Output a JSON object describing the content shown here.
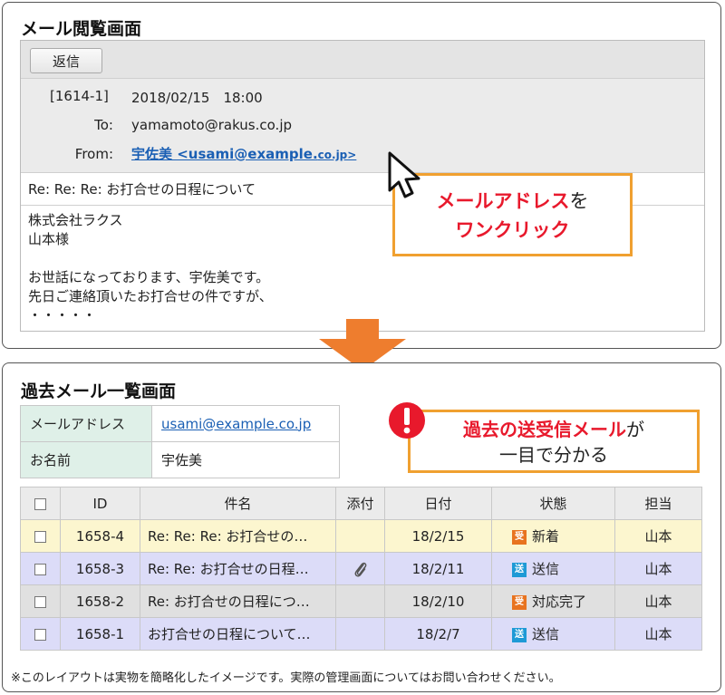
{
  "mail_view": {
    "title": "メール閲覧画面",
    "reply_label": "返信",
    "mail_no": "[1614-1]",
    "datetime": "2018/02/15　18:00",
    "to_label": "To:",
    "to_value": "yamamoto@rakus.co.jp",
    "from_label": "From:",
    "from_value_main": "宇佐美 <usami@example.",
    "from_value_tail": "co.jp>",
    "subject": "Re: Re: Re: お打合せの日程について",
    "body_lines": [
      "株式会社ラクス",
      "山本様",
      "",
      "お世話になっております、宇佐美です。",
      "先日ご連絡頂いたお打合せの件ですが、",
      "・・・・・"
    ],
    "callout_red": "メールアドレス",
    "callout_black": "を",
    "callout_line2": "ワンクリック"
  },
  "past_mail": {
    "title": "過去メール一覧画面",
    "info": {
      "address_label": "メールアドレス",
      "address_value": "usami@example.co.jp",
      "name_label": "お名前",
      "name_value": "宇佐美"
    },
    "callout_red": "過去の送受信メール",
    "callout_black": "が",
    "callout_line2": "一目で分かる",
    "columns": [
      "ID",
      "件名",
      "添付",
      "日付",
      "状態",
      "担当"
    ],
    "rows": [
      {
        "id": "1658-4",
        "subject": "Re: Re: Re: お打合せの…",
        "attach": "",
        "date": "18/2/15",
        "badge": "受",
        "status": "新着",
        "owner": "山本"
      },
      {
        "id": "1658-3",
        "subject": "Re: Re: お打合せの日程…",
        "attach": "paperclip-icon",
        "date": "18/2/11",
        "badge": "送",
        "status": "送信",
        "owner": "山本"
      },
      {
        "id": "1658-2",
        "subject": "Re: お打合せの日程につ…",
        "attach": "",
        "date": "18/2/10",
        "badge": "受",
        "status": "対応完了",
        "owner": "山本"
      },
      {
        "id": "1658-1",
        "subject": "お打合せの日程について…",
        "attach": "",
        "date": "18/2/7",
        "badge": "送",
        "status": "送信",
        "owner": "山本"
      }
    ]
  },
  "footnote": "※このレイアウトは実物を簡略化したイメージです。実際の管理画面についてはお問い合わせください。",
  "colors": {
    "accent_red": "#e8192c",
    "callout_border": "#f0a030",
    "arrow": "#ee7d2e",
    "link_blue": "#1a5fb4",
    "badge_receive": "#e8731f",
    "badge_send": "#1e9ad6"
  }
}
